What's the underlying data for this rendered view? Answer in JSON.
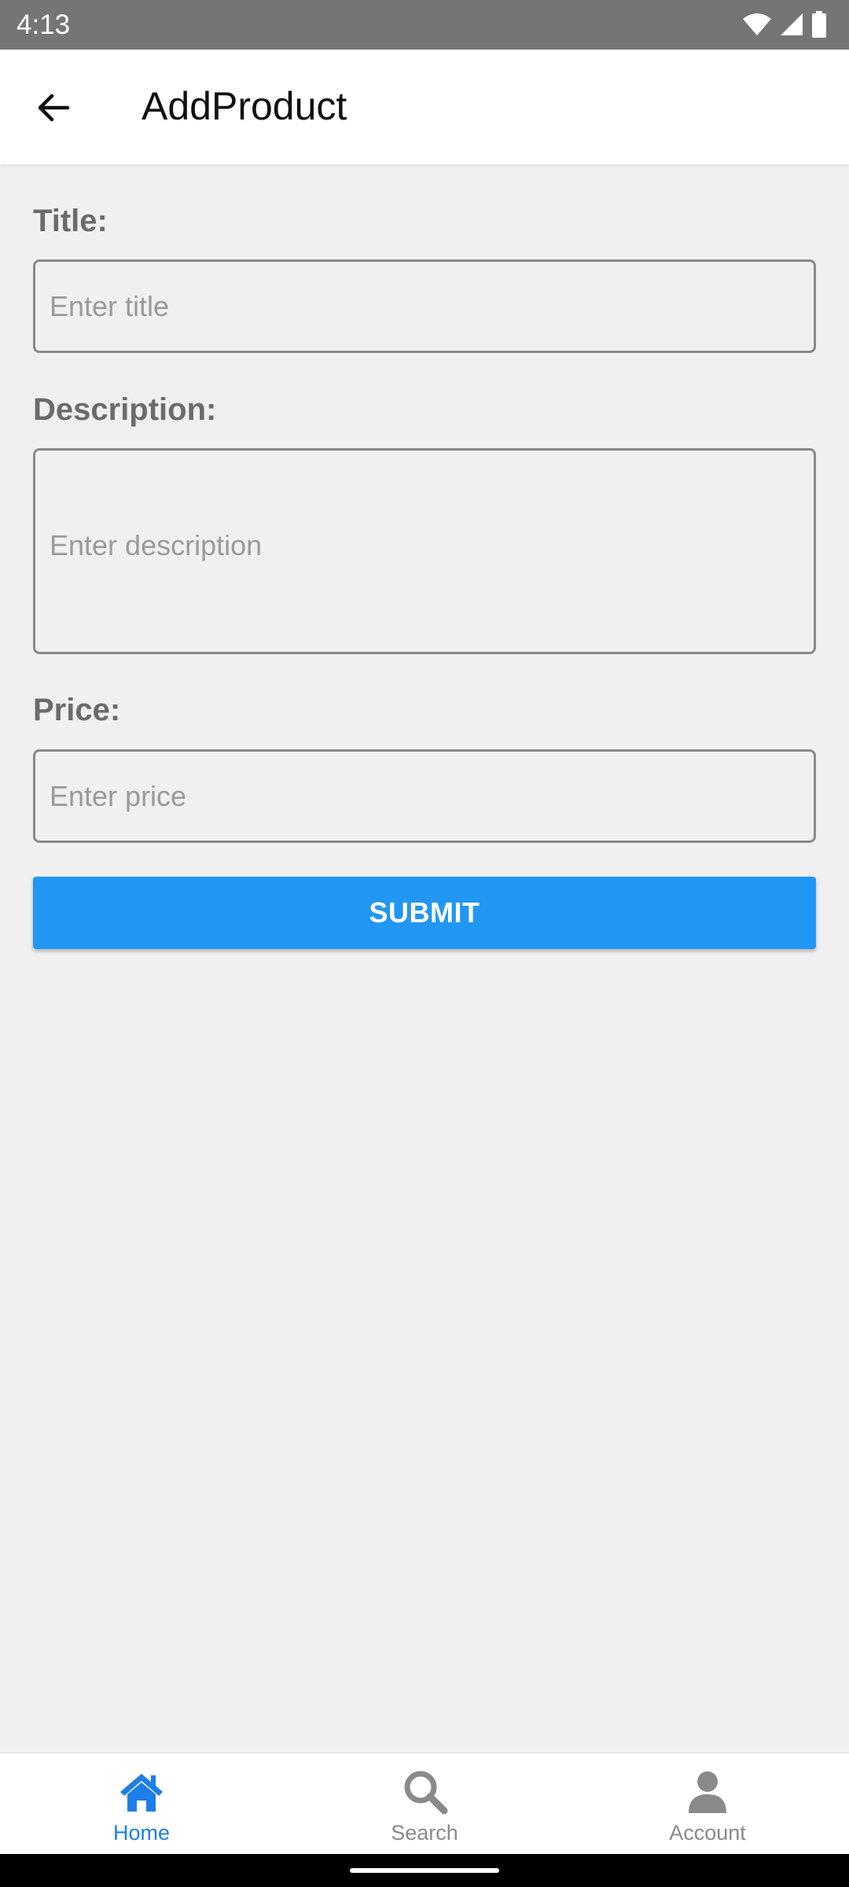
{
  "status_bar": {
    "time": "4:13",
    "icons": [
      "wifi-icon",
      "cellular-signal-icon",
      "battery-icon"
    ]
  },
  "app_bar": {
    "title": "AddProduct",
    "back_icon": "arrow-left-icon"
  },
  "form": {
    "title": {
      "label": "Title:",
      "placeholder": "Enter title",
      "value": ""
    },
    "description": {
      "label": "Description:",
      "placeholder": "Enter description",
      "value": ""
    },
    "price": {
      "label": "Price:",
      "placeholder": "Enter price",
      "value": ""
    },
    "submit_label": "SUBMIT"
  },
  "bottom_nav": {
    "active": "Home",
    "items": [
      {
        "label": "Home",
        "icon": "home-icon"
      },
      {
        "label": "Search",
        "icon": "search-icon"
      },
      {
        "label": "Account",
        "icon": "user-icon"
      }
    ]
  },
  "colors": {
    "accent": "#2196f3",
    "nav_active": "#1e7ee8",
    "nav_inactive": "#8a8a8a",
    "status_bar": "#757575",
    "background": "#f0f0f0"
  }
}
